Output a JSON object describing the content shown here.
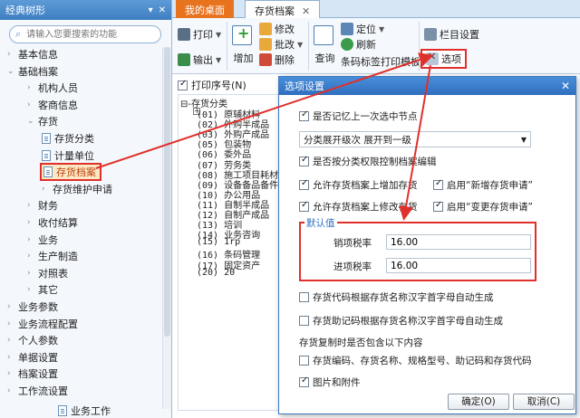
{
  "left_panel": {
    "title": "经典树形",
    "pin_icons": [
      "▾",
      "✕"
    ],
    "search_placeholder": "请输入您要搜索的功能",
    "items": [
      {
        "label": "基本信息",
        "level": 0,
        "arrow": "›"
      },
      {
        "label": "基础档案",
        "level": 0,
        "arrow": "⌄"
      },
      {
        "label": "机构人员",
        "level": 1,
        "arrow": "›"
      },
      {
        "label": "客商信息",
        "level": 1,
        "arrow": "›"
      },
      {
        "label": "存货",
        "level": 1,
        "arrow": "⌄"
      },
      {
        "label": "存货分类",
        "level": 2,
        "icon": true
      },
      {
        "label": "计量单位",
        "level": 2,
        "icon": true
      },
      {
        "label": "存货档案",
        "level": 2,
        "icon": true,
        "current": true
      },
      {
        "label": "存货维护申请",
        "level": 2,
        "arrow": "›"
      },
      {
        "label": "财务",
        "level": 1,
        "arrow": "›"
      },
      {
        "label": "收付结算",
        "level": 1,
        "arrow": "›"
      },
      {
        "label": "业务",
        "level": 1,
        "arrow": "›"
      },
      {
        "label": "生产制造",
        "level": 1,
        "arrow": "›"
      },
      {
        "label": "对照表",
        "level": 1,
        "arrow": "›"
      },
      {
        "label": "其它",
        "level": 1,
        "arrow": "›"
      },
      {
        "label": "业务参数",
        "level": 0,
        "arrow": "›"
      },
      {
        "label": "业务流程配置",
        "level": 0,
        "arrow": "›"
      },
      {
        "label": "个人参数",
        "level": 0,
        "arrow": "›"
      },
      {
        "label": "单据设置",
        "level": 0,
        "arrow": "›"
      },
      {
        "label": "档案设置",
        "level": 0,
        "arrow": "›"
      },
      {
        "label": "工作流设置",
        "level": 0,
        "arrow": "›"
      }
    ],
    "bottom_item": "业务工作"
  },
  "tabs": [
    {
      "label": "我的桌面"
    },
    {
      "label": "存货档案",
      "close": "✕"
    }
  ],
  "ribbon": {
    "print": "打印",
    "export": "输出",
    "add": "增加",
    "modify": "修改",
    "batch_modify": "批改",
    "delete": "删除",
    "query": "查询",
    "locate": "定位",
    "refresh": "刷新",
    "barcode_group": "条码标签打印模板",
    "column_settings": "栏目设置",
    "options": "选项"
  },
  "content": {
    "print_seq": "打印序号(N)",
    "category_root": "存货分类",
    "categories": [
      "(01) 原辅材料",
      "(02) 外购半成品",
      "(03) 外购产成品",
      "(05) 包装物",
      "(06) 委外品",
      "(07) 劳务类",
      "(08) 施工项目耗材",
      "(09) 设备备品备件",
      "(10) 办公用品",
      "(11) 自制半成品",
      "(12) 自制产成品",
      "(13) 培训",
      "(14) 业务咨询",
      "(15) 1rp",
      "(16) 条码管理",
      "(17) 固定资产",
      "(20) 20"
    ]
  },
  "dialog": {
    "title": "选项设置",
    "close": "✕",
    "remember_node": {
      "label": "是否记忆上一次选中节点",
      "checked": true
    },
    "expand_label": "分类展开级次",
    "expand_value": "展开到一级",
    "by_category_perm": {
      "label": "是否按分类权限控制档案编辑",
      "checked": true
    },
    "allow_add": {
      "label": "允许存货档案上增加存货",
      "checked": true
    },
    "enable_add_req": {
      "label": "启用“新增存货申请”",
      "checked": true
    },
    "allow_modify": {
      "label": "允许存货档案上修改存货",
      "checked": true
    },
    "enable_change_req": {
      "label": "启用“变更存货申请”",
      "checked": true
    },
    "default_group": "默认值",
    "sales_tax_label": "销项税率",
    "sales_tax_value": "16.00",
    "input_tax_label": "进项税率",
    "input_tax_value": "16.00",
    "auto_code": {
      "label": "存货代码根据存货名称汉字首字母自动生成",
      "checked": false
    },
    "auto_mnemonic": {
      "label": "存货助记码根据存货名称汉字首字母自动生成",
      "checked": false
    },
    "copy_section": "存货复制时是否包含以下内容",
    "copy_codes": {
      "label": "存货编码、存货名称、规格型号、助记码和存货代码",
      "checked": false
    },
    "copy_images": {
      "label": "图片和附件",
      "checked": true
    },
    "ok": "确定(O)",
    "cancel": "取消(C)"
  },
  "colors": {
    "highlight_red": "#e0302b",
    "title_blue": "#3f7fc2",
    "tab_orange": "#e8731f"
  }
}
